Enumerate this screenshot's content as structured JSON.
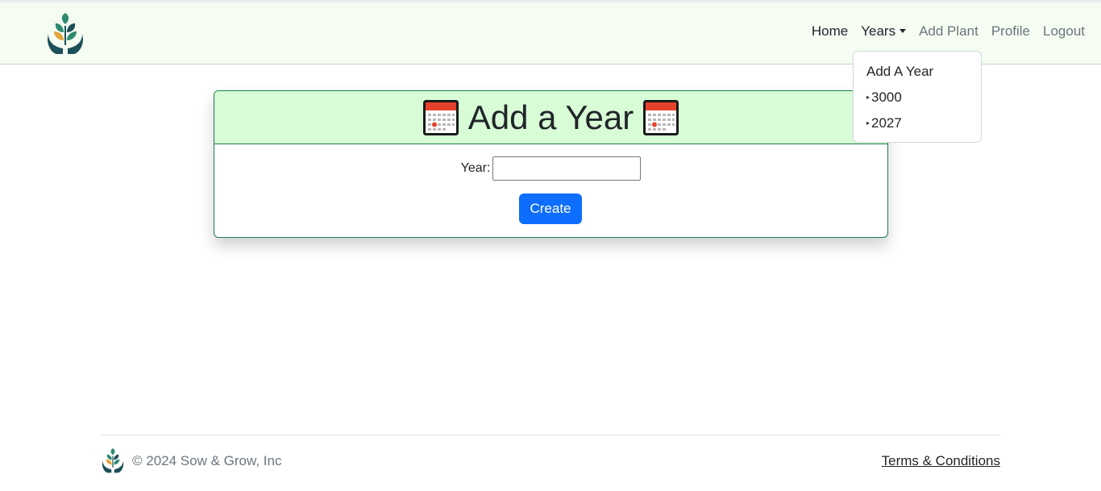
{
  "navbar": {
    "logo_icon": "sprout-in-hands-logo-icon",
    "links": {
      "home": "Home",
      "years": "Years",
      "add_plant": "Add Plant",
      "profile": "Profile",
      "logout": "Logout"
    }
  },
  "years_dropdown": {
    "expanded": true,
    "items": [
      {
        "label": "Add A Year",
        "marker": ""
      },
      {
        "label": "3000",
        "marker": "▸"
      },
      {
        "label": "2027",
        "marker": "▸"
      }
    ]
  },
  "card": {
    "icon": "calendar-icon",
    "title": "Add a Year",
    "form": {
      "year_label": "Year:",
      "year_value": "",
      "submit_label": "Create"
    }
  },
  "footer": {
    "copyright": "© 2024 Sow & Grow, Inc",
    "terms": "Terms & Conditions"
  },
  "colors": {
    "navbar_bg": "#f5fcf2",
    "card_header_bg": "#d8fcd6",
    "card_border": "#1d7f4f",
    "primary_button": "#0d6efd",
    "muted_text": "#6c757d"
  }
}
